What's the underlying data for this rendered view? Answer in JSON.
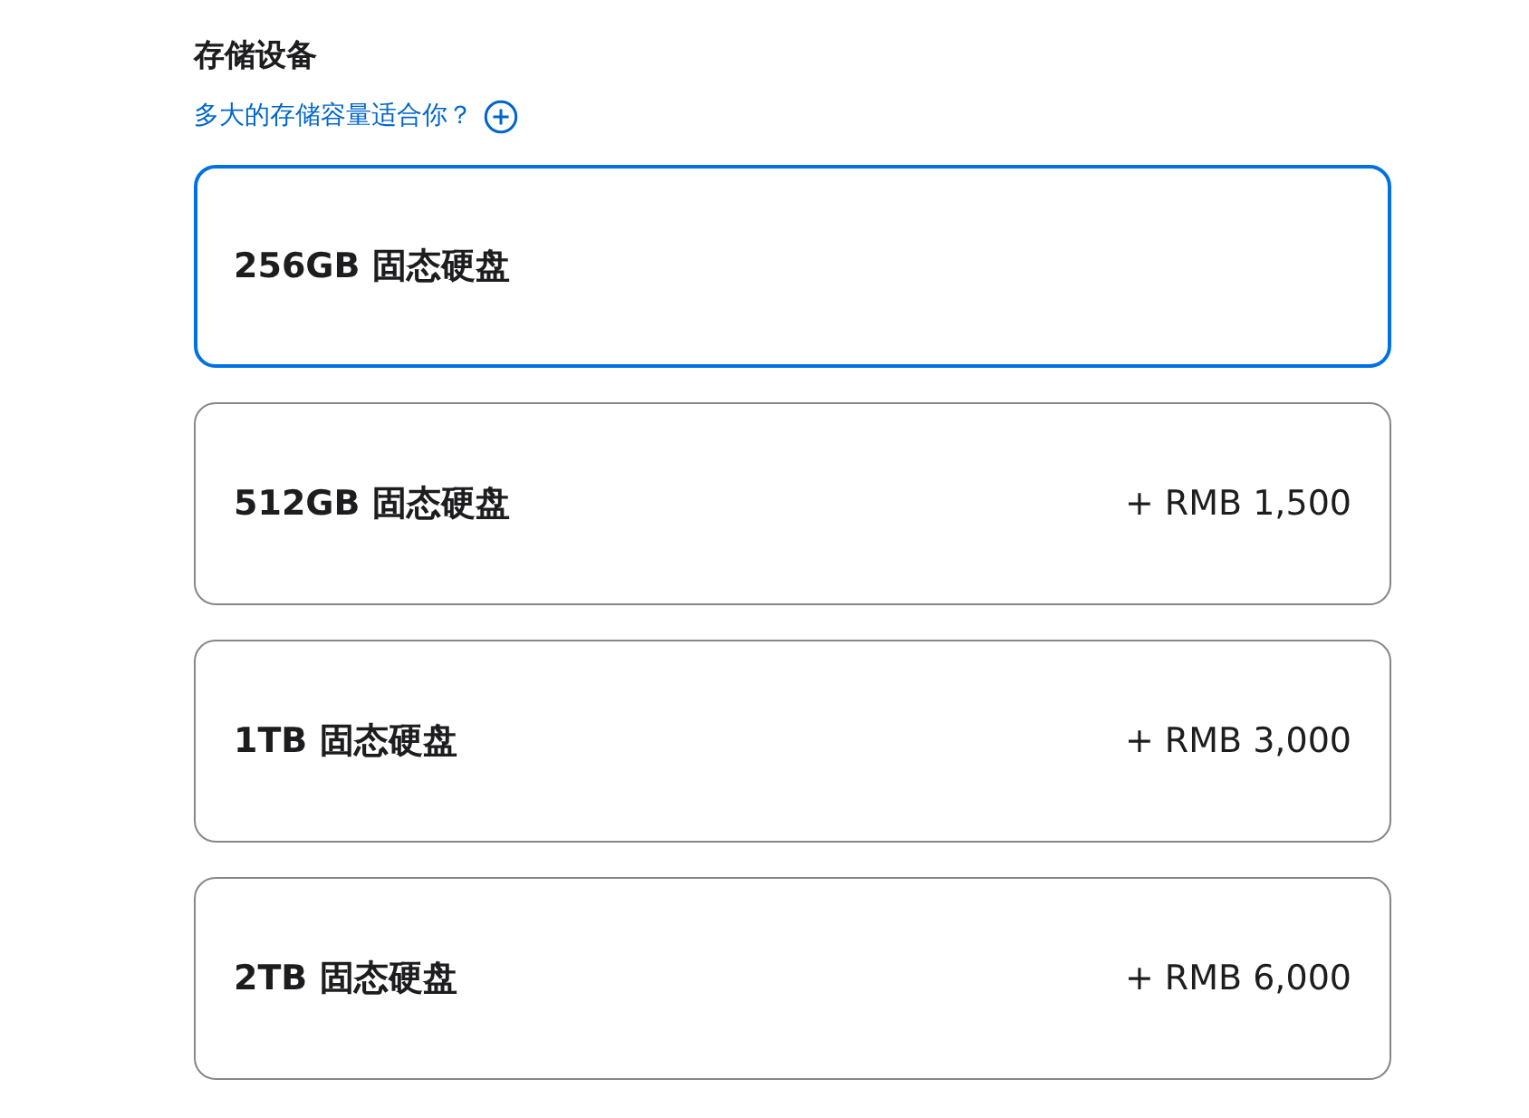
{
  "section": {
    "title": "存储设备",
    "help_link": "多大的存储容量适合你？"
  },
  "options": [
    {
      "label": "256GB 固态硬盘",
      "selected": true
    },
    {
      "label": "512GB 固态硬盘",
      "price": "+ RMB 1,500",
      "selected": false
    },
    {
      "label": "1TB 固态硬盘",
      "price": "+ RMB 3,000",
      "selected": false
    },
    {
      "label": "2TB 固态硬盘",
      "price": "+ RMB 6,000",
      "selected": false
    }
  ]
}
